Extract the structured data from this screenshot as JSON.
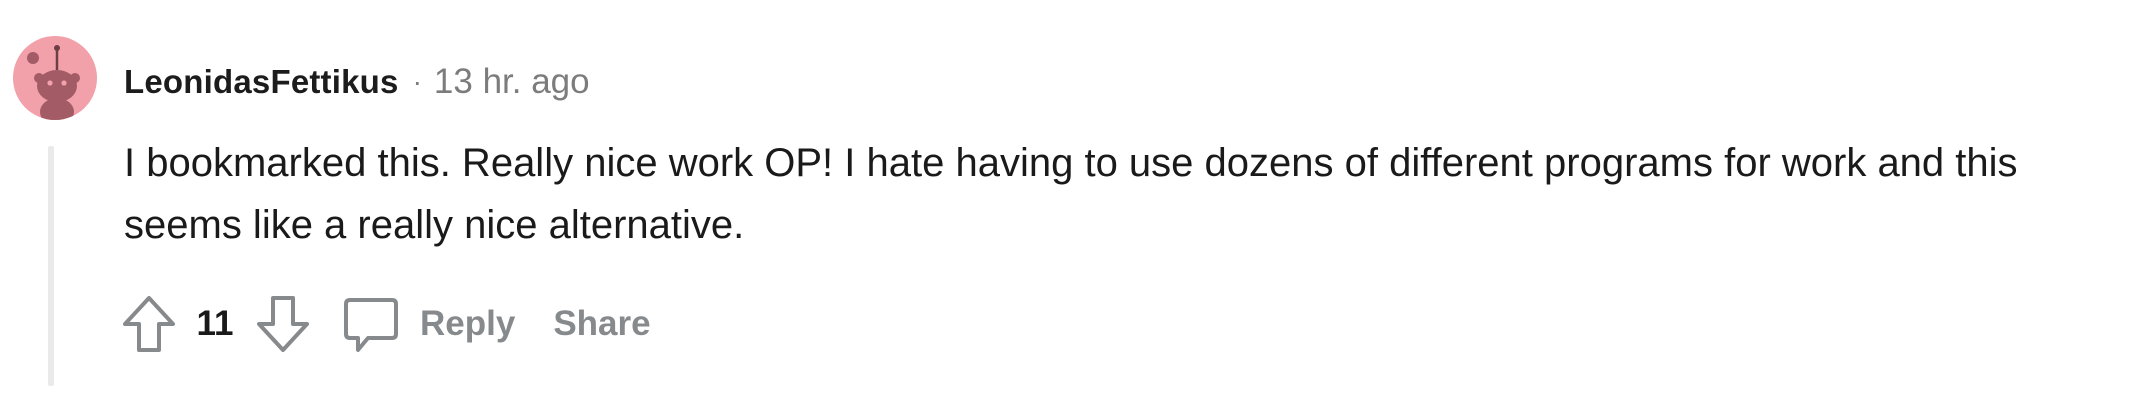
{
  "comment": {
    "author": "LeonidasFettikus",
    "separator": "·",
    "timestamp": "13 hr. ago",
    "body": "I bookmarked this. Really nice work OP! I hate having to use dozens of different programs for work and this seems like a really nice alternative.",
    "score": "11",
    "actions": {
      "reply_label": "Reply",
      "share_label": "Share"
    },
    "icons": {
      "avatar": "snoo-avatar",
      "upvote": "upvote-arrow-icon",
      "downvote": "downvote-arrow-icon",
      "reply": "speech-bubble-icon"
    }
  },
  "colors": {
    "avatar_bg": "#f2a0aa",
    "muted_text": "#878a8c",
    "body_text": "#1a1a1b",
    "thread_line": "#eaeaea"
  }
}
